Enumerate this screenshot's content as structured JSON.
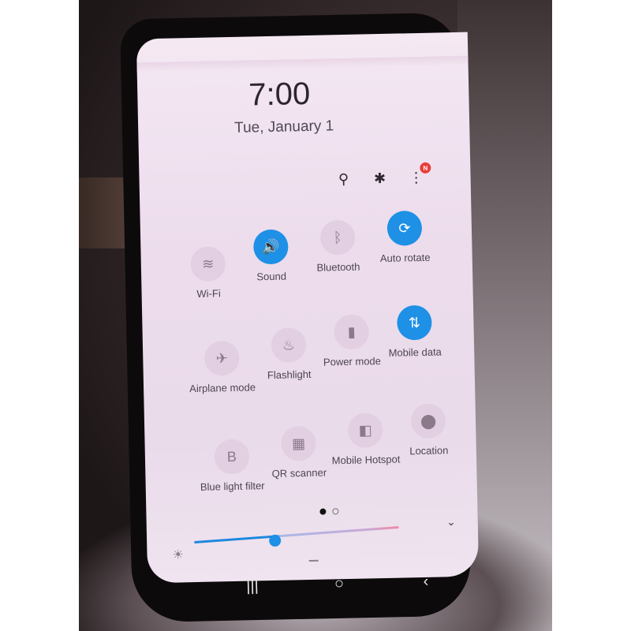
{
  "lockscreen": {
    "time": "7:00",
    "date": "Tue, January 1"
  },
  "top_icons": [
    {
      "name": "search-icon",
      "glyph": "⚲"
    },
    {
      "name": "gear-icon",
      "glyph": "✱"
    },
    {
      "name": "more-options-icon",
      "glyph": "⋮",
      "badge": "N"
    }
  ],
  "quick_settings": [
    {
      "label": "Wi-Fi",
      "icon": "wifi-icon",
      "glyph": "≋",
      "active": false
    },
    {
      "label": "Sound",
      "icon": "sound-icon",
      "glyph": "🔊",
      "active": true
    },
    {
      "label": "Bluetooth",
      "icon": "bluetooth-icon",
      "glyph": "ᛒ",
      "active": false
    },
    {
      "label": "Auto rotate",
      "icon": "auto-rotate-icon",
      "glyph": "⟳",
      "active": true
    },
    {
      "label": "Airplane mode",
      "icon": "airplane-icon",
      "glyph": "✈",
      "active": false
    },
    {
      "label": "Flashlight",
      "icon": "flashlight-icon",
      "glyph": "♨",
      "active": false
    },
    {
      "label": "Power mode",
      "icon": "battery-icon",
      "glyph": "▮",
      "active": false
    },
    {
      "label": "Mobile data",
      "icon": "mobile-data-icon",
      "glyph": "⇅",
      "active": true
    },
    {
      "label": "Blue light filter",
      "icon": "blue-light-icon",
      "glyph": "B",
      "active": false
    },
    {
      "label": "QR scanner",
      "icon": "qr-icon",
      "glyph": "▦",
      "active": false
    },
    {
      "label": "Mobile Hotspot",
      "icon": "hotspot-icon",
      "glyph": "◧",
      "active": false
    },
    {
      "label": "Location",
      "icon": "location-icon",
      "glyph": "⬤",
      "active": false
    }
  ],
  "pager": {
    "pages": 2,
    "current": 1
  },
  "brightness": {
    "level_percent": 40
  },
  "navigation": {
    "recents": "|||",
    "home": "○",
    "back": "‹"
  },
  "expand_glyph": "⌄",
  "brightness_glyph": "☀"
}
